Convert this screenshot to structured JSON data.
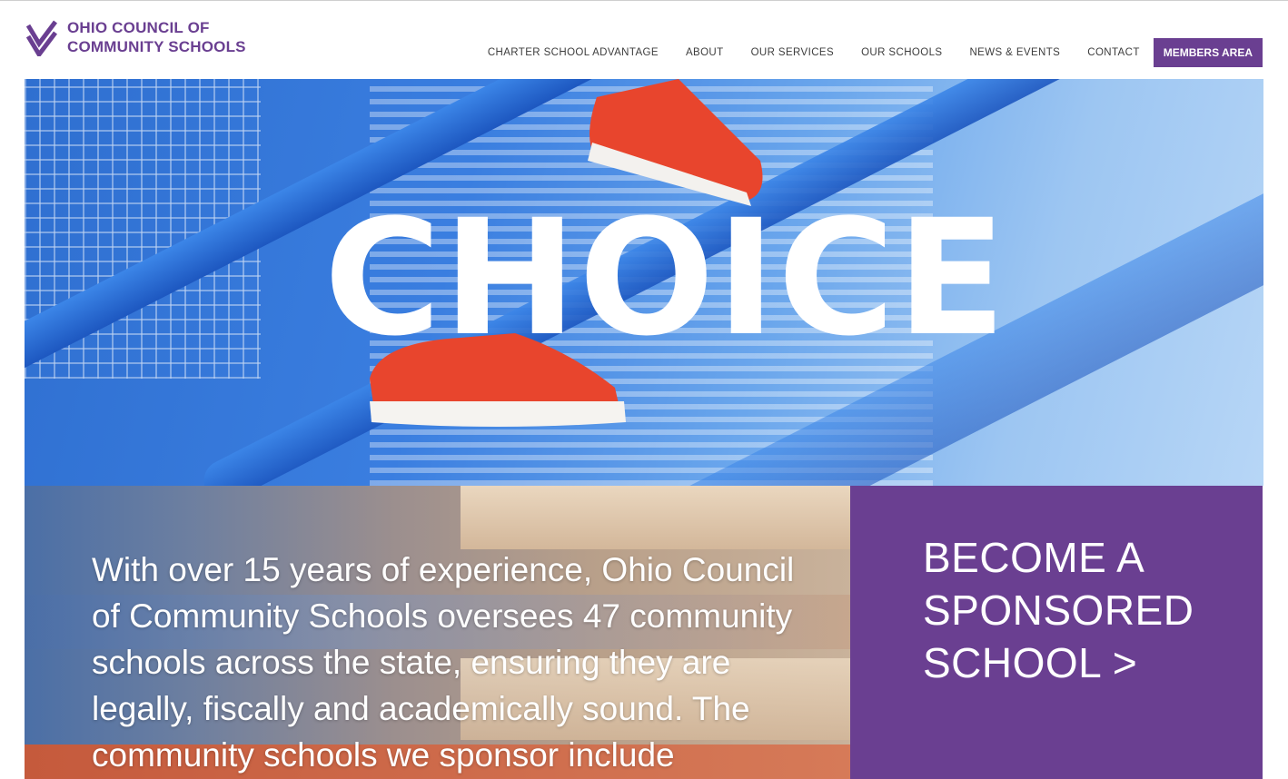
{
  "brand": {
    "line1": "OHIO COUNCIL OF",
    "line2": "COMMUNITY SCHOOLS",
    "icon": "double-chevron-logo-icon",
    "color": "#6a3f91"
  },
  "nav": {
    "items": [
      {
        "label": "CHARTER SCHOOL ADVANTAGE"
      },
      {
        "label": "ABOUT"
      },
      {
        "label": "OUR SERVICES"
      },
      {
        "label": "OUR SCHOOLS"
      },
      {
        "label": "NEWS & EVENTS"
      },
      {
        "label": "CONTACT"
      }
    ],
    "members_label": "MEMBERS AREA"
  },
  "hero": {
    "word": "CHOICE",
    "image": "photo of person in red sneakers climbing blue stairs"
  },
  "intro": {
    "text": "With over 15 years of experience, Ohio Council of Community Schools oversees 47 community schools across the state, ensuring they are legally, fiscally and academically sound. The community schools we sponsor include"
  },
  "cta": {
    "line1": "BECOME A",
    "line2": "SPONSORED",
    "line3": "SCHOOL >"
  }
}
